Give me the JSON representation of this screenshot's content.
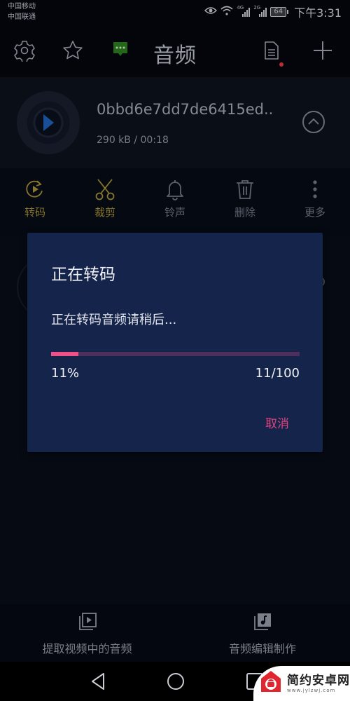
{
  "status_bar": {
    "carrier1": "中国移动",
    "carrier2": "中国联通",
    "sim1_network": "4G",
    "sim2_network": "2G",
    "battery": "64",
    "time": "下午3:31",
    "icons": [
      "eye-icon",
      "wifi-icon",
      "signal-icon",
      "signal-icon",
      "battery-icon"
    ]
  },
  "toolbar": {
    "title": "音频",
    "icons": [
      "gear-icon",
      "star-icon",
      "chat-icon",
      "document-icon",
      "plus-icon"
    ],
    "notification_dot_color": "#e5323d"
  },
  "file": {
    "name": "0bbd6e7dd7de6415ed..",
    "meta": "290 kB / 00:18"
  },
  "actions": [
    {
      "label": "转码",
      "icon": "convert-icon"
    },
    {
      "label": "裁剪",
      "icon": "scissors-icon"
    },
    {
      "label": "铃声",
      "icon": "bell-icon"
    },
    {
      "label": "删除",
      "icon": "trash-icon"
    },
    {
      "label": "更多",
      "icon": "more-vertical-icon"
    }
  ],
  "dialog": {
    "title": "正在转码",
    "message": "正在转码音频请稍后...",
    "progress_percent": 11,
    "percent_label": "11%",
    "count_label": "11/100",
    "cancel_label": "取消",
    "accent_color": "#f0508a"
  },
  "bottom_tabs": [
    {
      "label": "提取视频中的音频",
      "icon": "video-library-icon"
    },
    {
      "label": "音频编辑制作",
      "icon": "music-library-icon"
    }
  ],
  "nav": {
    "icons": [
      "back-icon",
      "home-icon",
      "recents-icon"
    ]
  },
  "watermark": {
    "text": "简约安卓网",
    "url": "www.jylzwj.com"
  }
}
